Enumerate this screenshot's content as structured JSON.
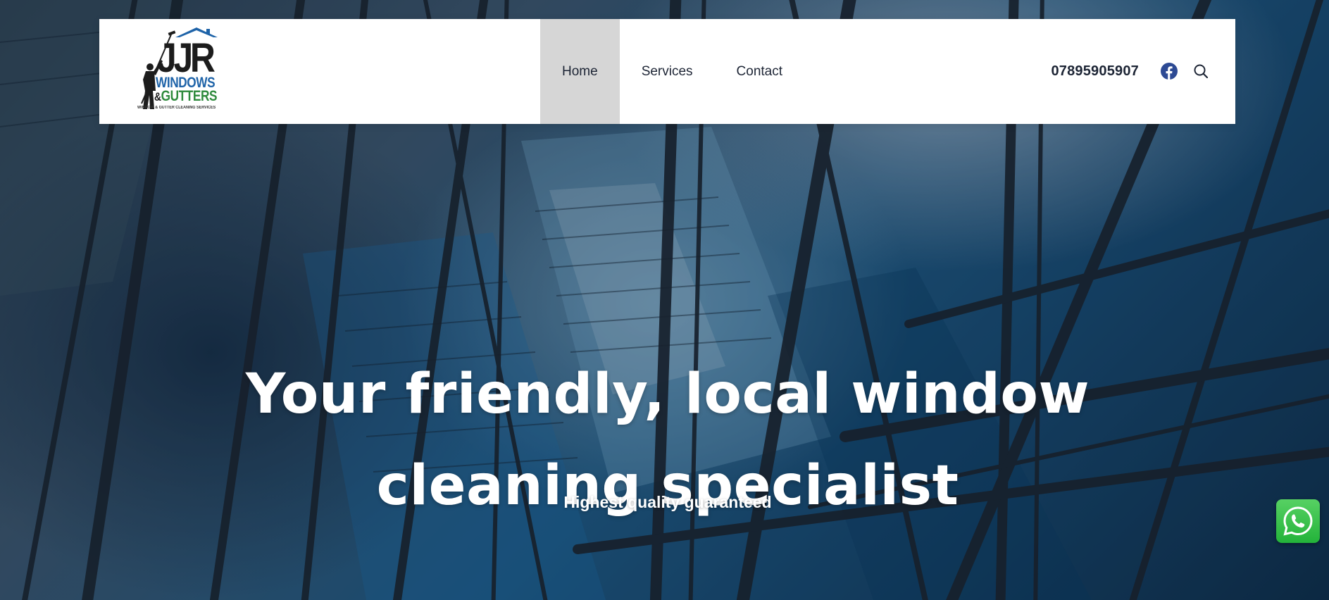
{
  "logo": {
    "brand": "JJR",
    "line1": "WINDOWS",
    "line2_amp": "&",
    "line2": "GUTTERS",
    "tagline": "WINDOW & GUTTER CLEANING SERVICES"
  },
  "nav": {
    "items": [
      {
        "label": "Home",
        "active": true
      },
      {
        "label": "Services",
        "active": false
      },
      {
        "label": "Contact",
        "active": false
      }
    ]
  },
  "header": {
    "phone": "07895905907",
    "facebook_icon": "facebook-icon",
    "search_icon": "search-icon"
  },
  "hero": {
    "title_line1": "Your friendly, local window",
    "title_line2": "cleaning specialist",
    "subtitle": "Highest quality guaranteed"
  },
  "whatsapp": {
    "icon": "whatsapp-icon",
    "color": "#25D366"
  },
  "colors": {
    "nav_text": "#1d2535",
    "nav_active_bg": "#d6d6d6",
    "facebook_blue": "#2d4a94",
    "logo_blue": "#1e63a8",
    "logo_green": "#2e8a3c"
  }
}
